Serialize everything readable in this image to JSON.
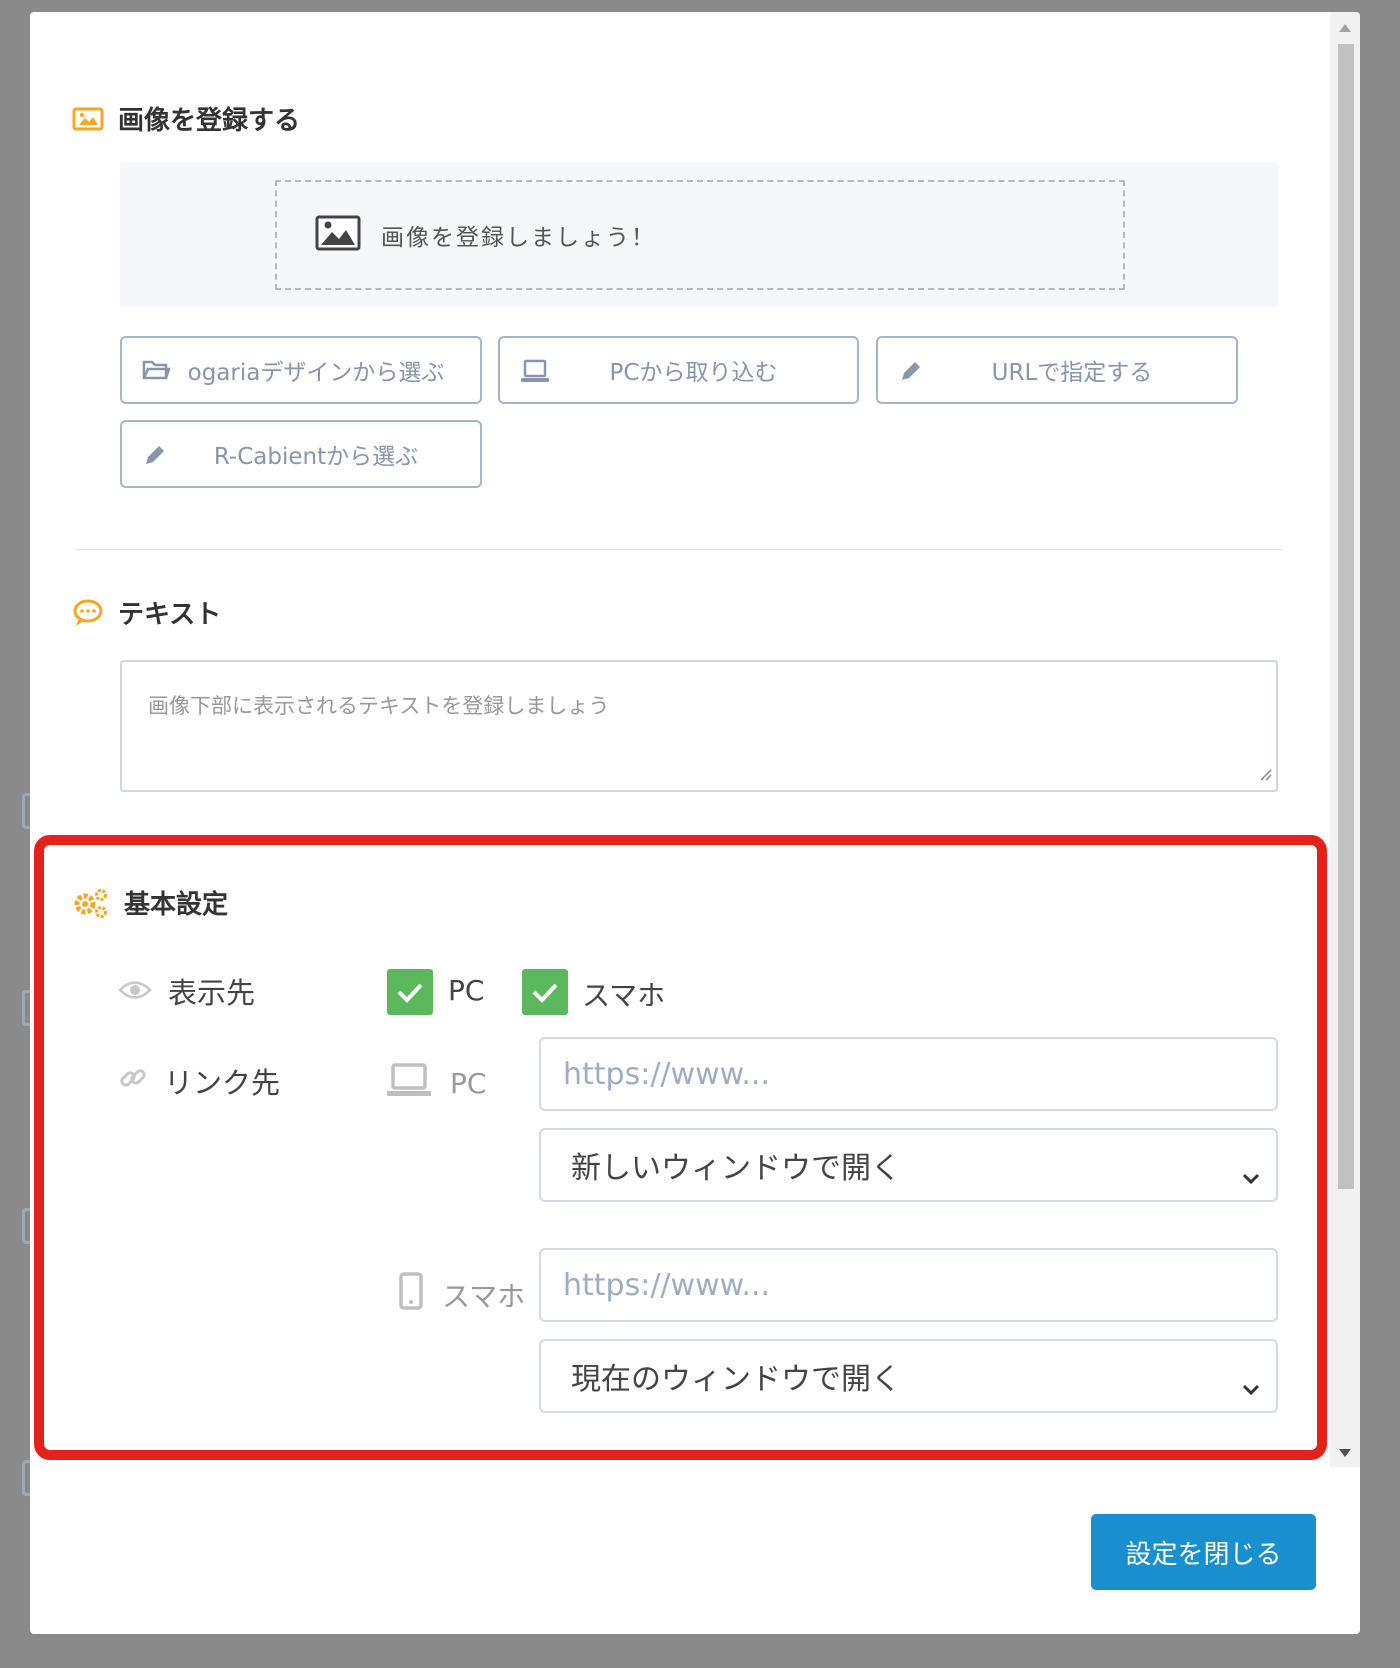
{
  "image_section": {
    "title": "画像を登録する",
    "dropzone_text": "画像を登録しましょう！",
    "buttons": {
      "ogaria": "ogariaデザインから選ぶ",
      "pc": "PCから取り込む",
      "url": "URLで指定する",
      "rcabient": "R-Cabientから選ぶ"
    }
  },
  "text_section": {
    "title": "テキスト",
    "placeholder": "画像下部に表示されるテキストを登録しましょう"
  },
  "basic_settings": {
    "title": "基本設定",
    "display_label": "表示先",
    "display_options": [
      {
        "label": "PC",
        "checked": true
      },
      {
        "label": "スマホ",
        "checked": true
      }
    ],
    "link_label": "リンク先",
    "pc": {
      "label": "PC",
      "url_placeholder": "https://www...",
      "target": "新しいウィンドウで開く"
    },
    "sp": {
      "label": "スマホ",
      "url_placeholder": "https://www...",
      "target": "現在のウィンドウで開く"
    }
  },
  "footer": {
    "close_label": "設定を閉じる"
  },
  "colors": {
    "accent_orange": "#f5a623",
    "check_green": "#5cb85c",
    "primary_blue": "#1a8fd0",
    "highlight_red": "#e3221a"
  }
}
